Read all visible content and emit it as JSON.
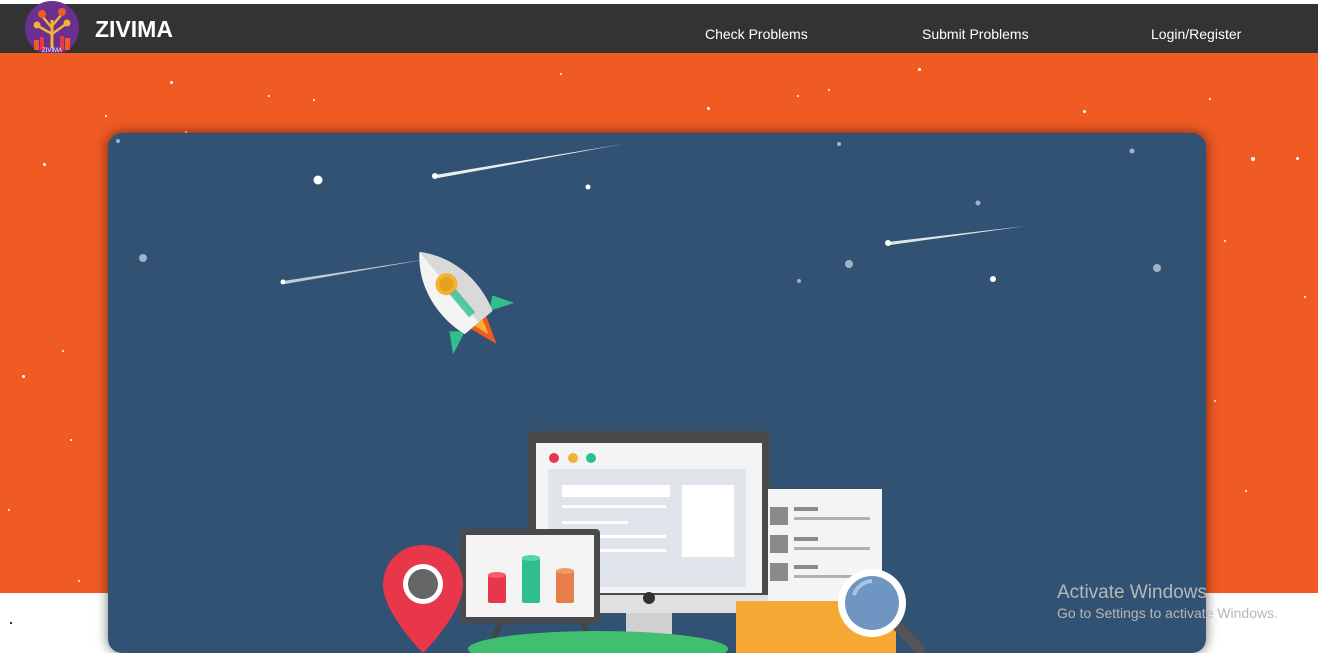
{
  "navbar": {
    "brand": "ZIVIMA",
    "logo_text": "ZIVIMA",
    "links": [
      {
        "label": "Check Problems"
      },
      {
        "label": "Submit Problems"
      },
      {
        "label": "Login/Register"
      }
    ]
  },
  "watermark": {
    "title": "Activate Windows",
    "subtitle": "Go to Settings to activate Windows."
  },
  "colors": {
    "navbar": "#333333",
    "hero": "#f05a23",
    "panel": "#315272",
    "accent_green": "#2fbf8f",
    "accent_yellow": "#f2b233",
    "accent_red": "#e8364b"
  },
  "icons": [
    "zivima-logo",
    "rocket-icon",
    "monitor-icon",
    "bar-chart-icon",
    "location-pin-icon",
    "magnifier-icon",
    "document-icon"
  ]
}
